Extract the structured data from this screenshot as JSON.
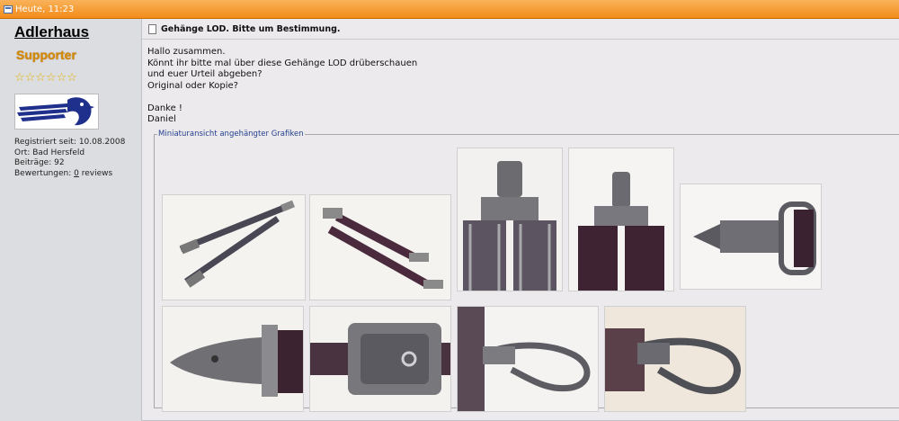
{
  "header": {
    "date": "Heute, 11:23",
    "icon": "post-icon"
  },
  "user": {
    "name": "Adlerhaus",
    "rank": "Supporter",
    "stars": "☆☆☆☆☆☆",
    "avatar_icon": "eagle-logo",
    "registered_label": "Registriert seit:",
    "registered_value": "10.08.2008",
    "location_label": "Ort:",
    "location_value": "Bad Hersfeld",
    "posts_label": "Beiträge:",
    "posts_value": "92",
    "ratings_label": "Bewertungen:",
    "ratings_count": "0",
    "ratings_unit": "reviews"
  },
  "post": {
    "title": "Gehänge LOD. Bitte um Bestimmung.",
    "lines": [
      "Hallo zusammen.",
      "Könnt ihr bitte mal über diese Gehänge LOD drüberschauen",
      "und euer Urteil abgeben?",
      "Original oder Kopie?",
      "",
      "Danke !",
      "Daniel"
    ]
  },
  "attachments": {
    "legend": "Miniaturansicht angehängter Grafiken",
    "thumbnails": [
      "dagger-hangers-overview-1",
      "dagger-hangers-overview-2",
      "hanger-top-clip-front",
      "hanger-top-clip-back",
      "buckle-and-clip-detail",
      "clip-end-detail",
      "ornate-buckle-detail",
      "snap-hook-detail-1",
      "snap-hook-detail-2"
    ]
  }
}
